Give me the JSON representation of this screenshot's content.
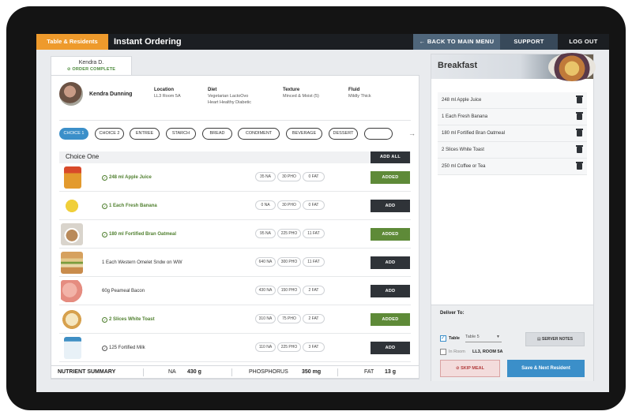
{
  "header": {
    "tab_label": "Table & Residents",
    "title": "Instant Ordering",
    "back_label": "BACK TO MAIN MENU",
    "support_label": "SUPPORT",
    "logout_label": "LOG OUT"
  },
  "resident_tab": {
    "name": "Kendra D.",
    "status": "ORDER COMPLETE"
  },
  "resident": {
    "name": "Kendra Dunning",
    "location_label": "Location",
    "location": "LL3 Room 5A",
    "diet_label": "Diet",
    "diet_line1": "Vegetarian LactoOvo",
    "diet_line2": "Heart Healthy Diabetic",
    "texture_label": "Texture",
    "texture": "Minced & Moist (5)",
    "fluid_label": "Fluid",
    "fluid": "Mildly Thick"
  },
  "categories": [
    "CHOICE 1",
    "CHOICE 2",
    "ENTREE",
    "STARCH",
    "BREAD",
    "CONDIMENT",
    "BEVERAGE",
    "DESSERT"
  ],
  "section": {
    "title": "Choice One",
    "add_all_label": "ADD ALL"
  },
  "items": [
    {
      "name": "248 ml Apple Juice",
      "na": "35 NA",
      "pho": "30 PHO",
      "fat": "0 FAT",
      "button": "ADDED",
      "added": true
    },
    {
      "name": "1 Each Fresh Banana",
      "na": "0 NA",
      "pho": "30 PHO",
      "fat": "0 FAT",
      "button": "ADD",
      "added": true
    },
    {
      "name": "180 ml Fortified Bran Oatmeal",
      "na": "95 NA",
      "pho": "225 PHO",
      "fat": "11 FAT",
      "button": "ADDED",
      "added": true
    },
    {
      "name": "1 Each Western Omelet Sndw on WW",
      "na": "640 NA",
      "pho": "300 PHO",
      "fat": "11 FAT",
      "button": "ADD",
      "added": false
    },
    {
      "name": "60g Peameal Bacon",
      "na": "430 NA",
      "pho": "150 PHO",
      "fat": "2 FAT",
      "button": "ADD",
      "added": false
    },
    {
      "name": "2 Slices White Toast",
      "na": "310 NA",
      "pho": "75 PHO",
      "fat": "2 FAT",
      "button": "ADDED",
      "added": true
    },
    {
      "name": "125 Fortified Milk",
      "na": "110 NA",
      "pho": "225 PHO",
      "fat": "3 FAT",
      "button": "ADD",
      "added": false
    }
  ],
  "nutrient_summary": {
    "label": "NUTRIENT SUMMARY",
    "na_label": "NA",
    "na_value": "430 g",
    "pho_label": "PHOSPHORUS",
    "pho_value": "350 mg",
    "fat_label": "FAT",
    "fat_value": "13 g"
  },
  "breakfast": {
    "title": "Breakfast",
    "items": [
      "248 ml Apple Juice",
      "1 Each Fresh Banana",
      "180 ml Fortified Bran Oatmeal",
      "2 Slices White Toast",
      "250 ml Coffee or Tea"
    ]
  },
  "deliver": {
    "title": "Deliver To:",
    "table_label": "Table",
    "table_value": "Table 5",
    "inroom_label": "In Room",
    "inroom_value": "LL3, ROOM 5A",
    "server_notes_label": "SERVER NOTES",
    "skip_label": "SKIP MEAL",
    "save_label": "Save & Next Resident"
  },
  "colors": {
    "accent": "#3b8fc9",
    "added": "#5e8a38",
    "tab": "#ee9a2c",
    "dark": "#2f3338"
  }
}
